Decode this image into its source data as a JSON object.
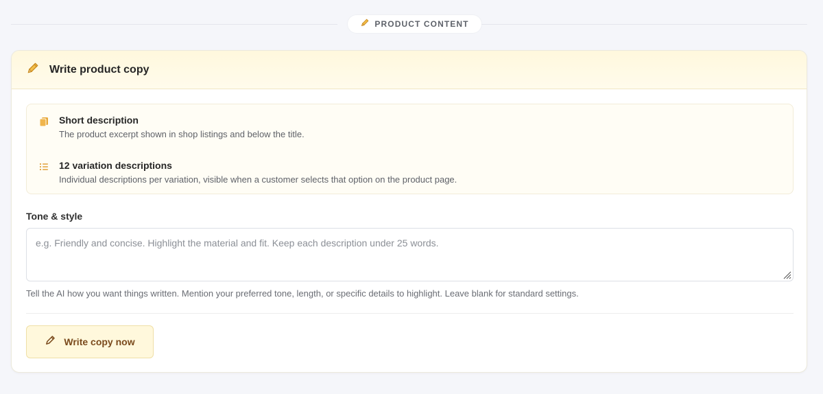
{
  "section": {
    "label": "PRODUCT CONTENT",
    "icon": "pencil-icon"
  },
  "card": {
    "title": "Write product copy",
    "icon": "pencil-icon"
  },
  "info_items": [
    {
      "icon": "copy-pages-icon",
      "title": "Short description",
      "description": "The product excerpt shown in shop listings and below the title."
    },
    {
      "icon": "list-icon",
      "title": "12 variation descriptions",
      "description": "Individual descriptions per variation, visible when a customer selects that option on the product page."
    }
  ],
  "tone": {
    "label": "Tone & style",
    "placeholder": "e.g. Friendly and concise. Highlight the material and fit. Keep each description under 25 words.",
    "value": "",
    "helper": "Tell the AI how you want things written. Mention your preferred tone, length, or specific details to highlight. Leave blank for standard settings."
  },
  "action": {
    "label": "Write copy now",
    "icon": "pencil-icon"
  },
  "colors": {
    "accent": "#d99a2b",
    "header_bg": "#fff8dd",
    "button_bg": "#fff8dc",
    "button_text": "#7a4a1c"
  }
}
